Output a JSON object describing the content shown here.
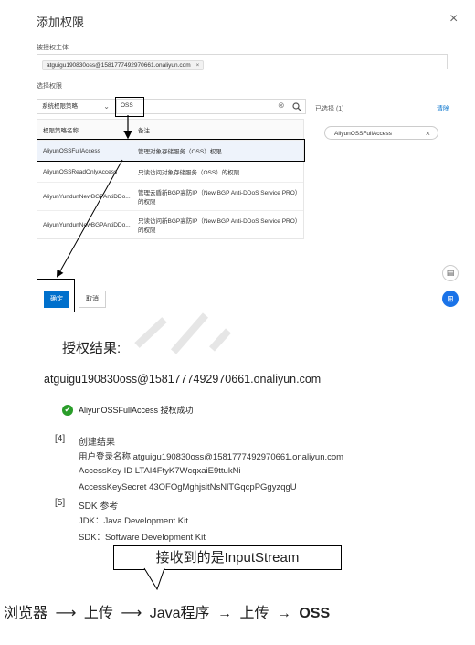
{
  "dialog": {
    "title": "添加权限",
    "close_icon": "×"
  },
  "principal": {
    "label": "被授权主体",
    "tag": "atguigu190830oss@1581777492970661.onaliyun.com",
    "tag_remove": "×"
  },
  "select": {
    "label": "选择权限",
    "policy_type": "系统权限策略",
    "search_value": "OSS",
    "clear_icon": "⊗",
    "search_icon": "search-icon"
  },
  "table": {
    "headers": [
      "权限策略名称",
      "备注"
    ],
    "rows": [
      {
        "name": "AliyunOSSFullAccess",
        "note": "管理对象存储服务（OSS）权限"
      },
      {
        "name": "AliyunOSSReadOnlyAccess",
        "note": "只读访问对象存储服务（OSS）的权限"
      },
      {
        "name": "AliyunYundunNewBGPAntiDDo...",
        "note": "管理云盾新BGP高防IP（New BGP Anti-DDoS Service PRO）的权限"
      },
      {
        "name": "AliyunYundunNewBGPAntiDDo...",
        "note": "只读访问新BGP高防IP（New BGP Anti-DDoS Service PRO）的权限"
      }
    ]
  },
  "selected": {
    "label": "已选择 (1)",
    "clear": "清除",
    "item": "AliyunOSSFullAccess",
    "item_remove": "×"
  },
  "footer": {
    "confirm": "确定",
    "cancel": "取消"
  },
  "result": {
    "title": "授权结果:",
    "account": "atguigu190830oss@1581777492970661.onaliyun.com",
    "success": "AliyunOSSFullAccess 授权成功"
  },
  "notes": {
    "n4_num": "[4]",
    "n4_title": "创建结果",
    "login_name": "用户登录名称 atguigu190830oss@1581777492970661.onaliyun.com",
    "access_key_id": "AccessKey ID LTAI4FtyK7WcqxaiE9ttukNi",
    "access_key_secret": "AccessKeySecret 43OFOgMghjsitNsNlTGqcpPGgyzqgU",
    "n5_num": "[5]",
    "n5_title": "SDK 参考",
    "jdk": "JDK：Java Development Kit",
    "sdk": "SDK：Software Development Kit"
  },
  "flow": {
    "callout": "接收到的是InputStream",
    "s1": "浏览器",
    "a1": "⟶",
    "s2": "上传",
    "a2": "⟶",
    "s3": "Java程序",
    "a3": "→",
    "s4": "上传",
    "a4": "→",
    "s5": "OSS"
  },
  "colors": {
    "accent": "#0070cc",
    "success": "#2a9d2a"
  }
}
